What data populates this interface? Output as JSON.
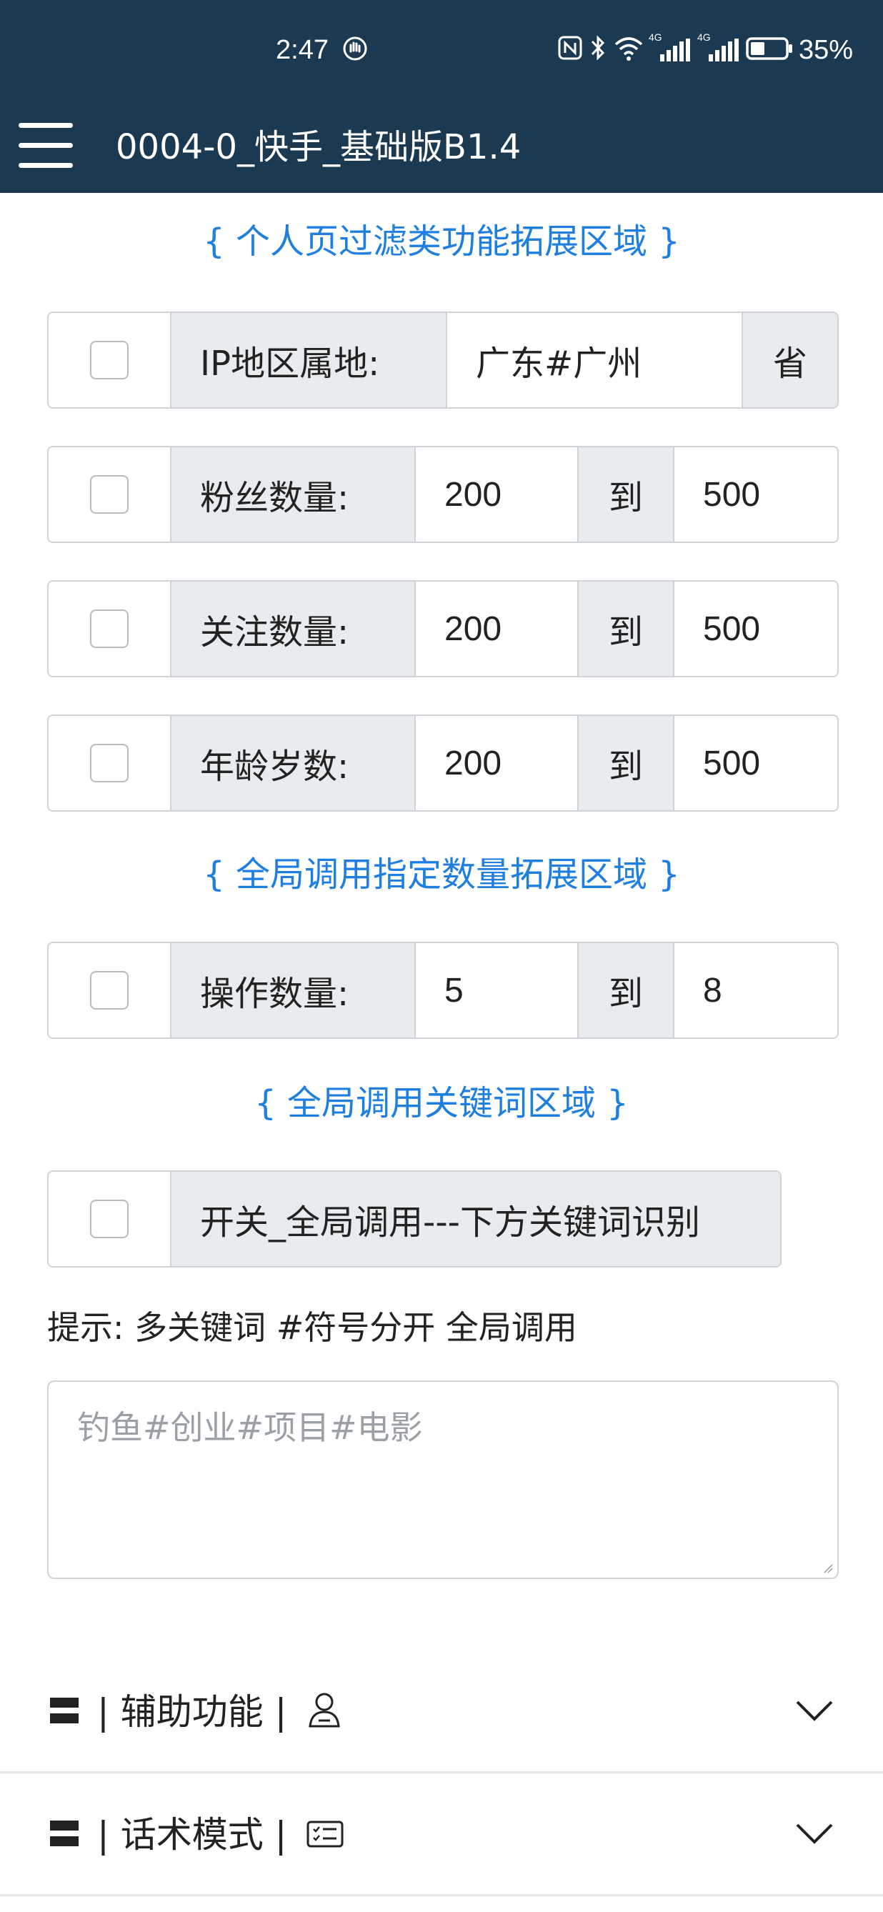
{
  "status": {
    "time": "2:47",
    "network": "4G",
    "battery": "35%"
  },
  "header": {
    "title": "0004-0_快手_基础版B1.4"
  },
  "sections": {
    "profile_filter": "{ 个人页过滤类功能拓展区域 }",
    "global_count": "{ 全局调用指定数量拓展区域 }",
    "global_keyword": "{ 全局调用关键词区域 }"
  },
  "filters": {
    "ip": {
      "label": "IP地区属地:",
      "value": "广东#广州",
      "suffix": "省"
    },
    "fans": {
      "label": "粉丝数量:",
      "min": "200",
      "to": "到",
      "max": "500"
    },
    "follow": {
      "label": "关注数量:",
      "min": "200",
      "to": "到",
      "max": "500"
    },
    "age": {
      "label": "年龄岁数:",
      "min": "200",
      "to": "到",
      "max": "500"
    }
  },
  "operation": {
    "label": "操作数量:",
    "min": "5",
    "to": "到",
    "max": "8"
  },
  "keyword_switch": {
    "label": "开关_全局调用---下方关键词识别"
  },
  "hint": "提示:  多关键词 #符号分开 全局调用",
  "keywords": {
    "placeholder": "钓鱼#创业#项目#电影"
  },
  "accordion": [
    {
      "title": "| 辅助功能 |",
      "icon": "user-icon"
    },
    {
      "title": "| 话术模式 |",
      "icon": "list-card-icon"
    }
  ],
  "colors": {
    "appbar": "#1b3a52",
    "accent": "#1f7fe0",
    "addon_bg": "#e9ecef",
    "border": "#d0d4d9"
  }
}
